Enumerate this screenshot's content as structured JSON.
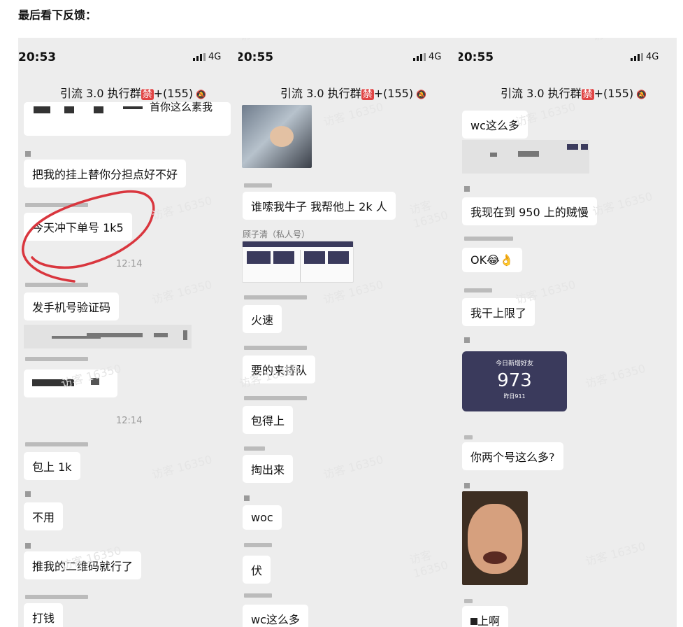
{
  "heading": "最后看下反馈：",
  "watermark": "访客 16350",
  "colors": {
    "red_circle": "#d9363e",
    "ban_badge": "#e04444",
    "card_bg": "#3a3a5c"
  },
  "panels": [
    {
      "time": "20:53",
      "network": "4G",
      "group_title": "引流 3.0 执行群",
      "ban_label": "禁",
      "member_count": "+(155)",
      "partial_text": "首你这么素我",
      "messages": [
        "把我的挂上替你分担点好不好",
        "今天冲下单号 1k5",
        "发手机号验证码",
        "包上 1k",
        "不用",
        "推我的二维码就行了",
        "打钱"
      ],
      "timestamps": [
        "12:14",
        "12:14"
      ]
    },
    {
      "time": "20:55",
      "network": "4G",
      "group_title": "引流 3.0 执行群",
      "ban_label": "禁",
      "member_count": "+(155)",
      "sender_label": "顾子清（私人号）",
      "messages": [
        "谁嗦我牛子 我帮他上 2k 人",
        "火速",
        "要的来排队",
        "包得上",
        "掏出来",
        "woc",
        "伏",
        "wc这么多"
      ]
    },
    {
      "time": "20:55",
      "network": "4G",
      "group_title": "引流 3.0 执行群",
      "ban_label": "禁",
      "member_count": "+(155)",
      "messages": [
        "wc这么多",
        "我现在到 950 上的贼慢",
        "OK",
        "我干上限了",
        "你两个号这么多?"
      ],
      "ok_emojis": "😂👌",
      "card": {
        "label": "今日新增好友",
        "value": "973",
        "sub": "昨日911"
      },
      "partial_last": "上啊"
    }
  ]
}
